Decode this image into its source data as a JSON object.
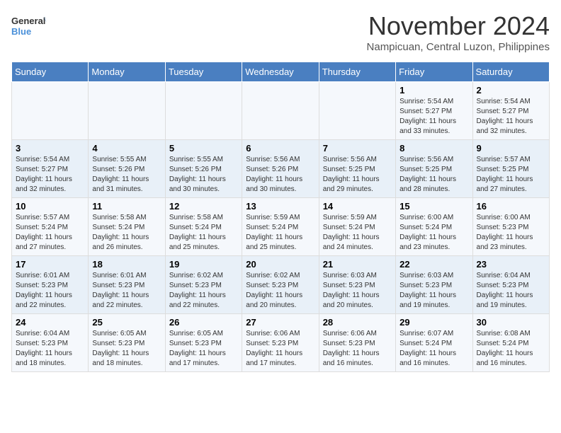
{
  "header": {
    "logo_line1": "General",
    "logo_line2": "Blue",
    "month": "November 2024",
    "location": "Nampicuan, Central Luzon, Philippines"
  },
  "weekdays": [
    "Sunday",
    "Monday",
    "Tuesday",
    "Wednesday",
    "Thursday",
    "Friday",
    "Saturday"
  ],
  "weeks": [
    [
      {
        "day": "",
        "sunrise": "",
        "sunset": "",
        "daylight": ""
      },
      {
        "day": "",
        "sunrise": "",
        "sunset": "",
        "daylight": ""
      },
      {
        "day": "",
        "sunrise": "",
        "sunset": "",
        "daylight": ""
      },
      {
        "day": "",
        "sunrise": "",
        "sunset": "",
        "daylight": ""
      },
      {
        "day": "",
        "sunrise": "",
        "sunset": "",
        "daylight": ""
      },
      {
        "day": "1",
        "sunrise": "5:54 AM",
        "sunset": "5:27 PM",
        "daylight": "11 hours and 33 minutes."
      },
      {
        "day": "2",
        "sunrise": "5:54 AM",
        "sunset": "5:27 PM",
        "daylight": "11 hours and 32 minutes."
      }
    ],
    [
      {
        "day": "3",
        "sunrise": "5:54 AM",
        "sunset": "5:27 PM",
        "daylight": "11 hours and 32 minutes."
      },
      {
        "day": "4",
        "sunrise": "5:55 AM",
        "sunset": "5:26 PM",
        "daylight": "11 hours and 31 minutes."
      },
      {
        "day": "5",
        "sunrise": "5:55 AM",
        "sunset": "5:26 PM",
        "daylight": "11 hours and 30 minutes."
      },
      {
        "day": "6",
        "sunrise": "5:56 AM",
        "sunset": "5:26 PM",
        "daylight": "11 hours and 30 minutes."
      },
      {
        "day": "7",
        "sunrise": "5:56 AM",
        "sunset": "5:25 PM",
        "daylight": "11 hours and 29 minutes."
      },
      {
        "day": "8",
        "sunrise": "5:56 AM",
        "sunset": "5:25 PM",
        "daylight": "11 hours and 28 minutes."
      },
      {
        "day": "9",
        "sunrise": "5:57 AM",
        "sunset": "5:25 PM",
        "daylight": "11 hours and 27 minutes."
      }
    ],
    [
      {
        "day": "10",
        "sunrise": "5:57 AM",
        "sunset": "5:24 PM",
        "daylight": "11 hours and 27 minutes."
      },
      {
        "day": "11",
        "sunrise": "5:58 AM",
        "sunset": "5:24 PM",
        "daylight": "11 hours and 26 minutes."
      },
      {
        "day": "12",
        "sunrise": "5:58 AM",
        "sunset": "5:24 PM",
        "daylight": "11 hours and 25 minutes."
      },
      {
        "day": "13",
        "sunrise": "5:59 AM",
        "sunset": "5:24 PM",
        "daylight": "11 hours and 25 minutes."
      },
      {
        "day": "14",
        "sunrise": "5:59 AM",
        "sunset": "5:24 PM",
        "daylight": "11 hours and 24 minutes."
      },
      {
        "day": "15",
        "sunrise": "6:00 AM",
        "sunset": "5:24 PM",
        "daylight": "11 hours and 23 minutes."
      },
      {
        "day": "16",
        "sunrise": "6:00 AM",
        "sunset": "5:23 PM",
        "daylight": "11 hours and 23 minutes."
      }
    ],
    [
      {
        "day": "17",
        "sunrise": "6:01 AM",
        "sunset": "5:23 PM",
        "daylight": "11 hours and 22 minutes."
      },
      {
        "day": "18",
        "sunrise": "6:01 AM",
        "sunset": "5:23 PM",
        "daylight": "11 hours and 22 minutes."
      },
      {
        "day": "19",
        "sunrise": "6:02 AM",
        "sunset": "5:23 PM",
        "daylight": "11 hours and 22 minutes."
      },
      {
        "day": "20",
        "sunrise": "6:02 AM",
        "sunset": "5:23 PM",
        "daylight": "11 hours and 20 minutes."
      },
      {
        "day": "21",
        "sunrise": "6:03 AM",
        "sunset": "5:23 PM",
        "daylight": "11 hours and 20 minutes."
      },
      {
        "day": "22",
        "sunrise": "6:03 AM",
        "sunset": "5:23 PM",
        "daylight": "11 hours and 19 minutes."
      },
      {
        "day": "23",
        "sunrise": "6:04 AM",
        "sunset": "5:23 PM",
        "daylight": "11 hours and 19 minutes."
      }
    ],
    [
      {
        "day": "24",
        "sunrise": "6:04 AM",
        "sunset": "5:23 PM",
        "daylight": "11 hours and 18 minutes."
      },
      {
        "day": "25",
        "sunrise": "6:05 AM",
        "sunset": "5:23 PM",
        "daylight": "11 hours and 18 minutes."
      },
      {
        "day": "26",
        "sunrise": "6:05 AM",
        "sunset": "5:23 PM",
        "daylight": "11 hours and 17 minutes."
      },
      {
        "day": "27",
        "sunrise": "6:06 AM",
        "sunset": "5:23 PM",
        "daylight": "11 hours and 17 minutes."
      },
      {
        "day": "28",
        "sunrise": "6:06 AM",
        "sunset": "5:23 PM",
        "daylight": "11 hours and 16 minutes."
      },
      {
        "day": "29",
        "sunrise": "6:07 AM",
        "sunset": "5:24 PM",
        "daylight": "11 hours and 16 minutes."
      },
      {
        "day": "30",
        "sunrise": "6:08 AM",
        "sunset": "5:24 PM",
        "daylight": "11 hours and 16 minutes."
      }
    ]
  ]
}
